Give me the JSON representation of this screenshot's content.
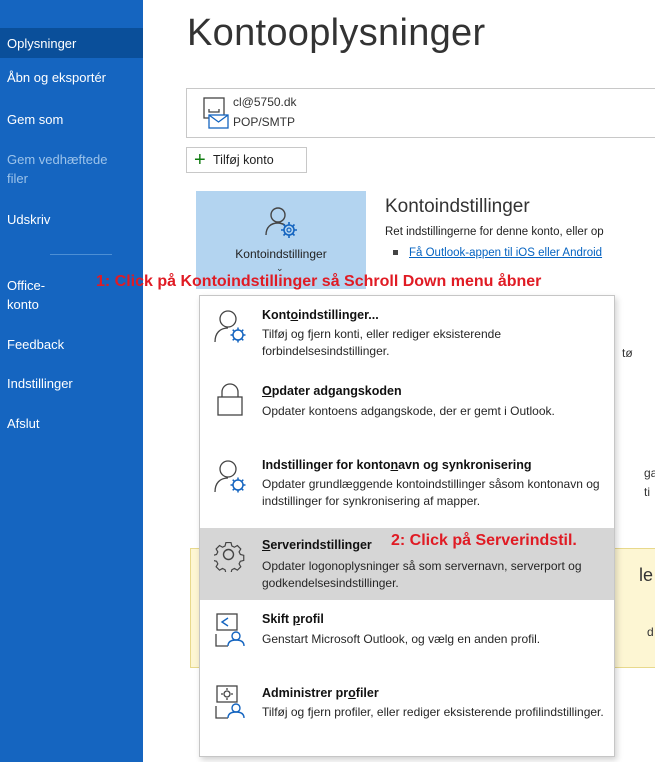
{
  "sidebar": {
    "items": [
      {
        "label": "Oplysninger"
      },
      {
        "label": "Åbn og eksportér"
      },
      {
        "label": "Gem som"
      },
      {
        "label": "Gem vedhæftede filer"
      },
      {
        "label": "Udskriv"
      },
      {
        "label": "Office-konto"
      },
      {
        "label": "Feedback"
      },
      {
        "label": "Indstillinger"
      },
      {
        "label": "Afslut"
      }
    ]
  },
  "main": {
    "title": "Kontooplysninger",
    "account": {
      "email": "cl@5750.dk",
      "type": "POP/SMTP"
    },
    "add_account_label": "Tilføj konto",
    "tile_label": "Kontoindstillinger",
    "section_title": "Kontoindstillinger",
    "section_desc": "Ret indstillingerne for denne konto, eller op",
    "section_link": "Få Outlook-appen til iOS eller Android"
  },
  "annotations": {
    "step1": "1: Click på Kontoindstillinger så Schroll Down menu åbner",
    "step2": "2: Click på Serverindstil."
  },
  "menu": {
    "items": [
      {
        "title_pre": "Kont",
        "title_u": "o",
        "title_post": "indstillinger...",
        "desc": "Tilføj og fjern konti, eller rediger eksisterende forbindelsesindstillinger.",
        "icon": "account-settings-icon"
      },
      {
        "title_pre": "",
        "title_u": "O",
        "title_post": "pdater adgangskoden",
        "desc": "Opdater kontoens adgangskode, der er gemt i Outlook.",
        "icon": "lock-icon"
      },
      {
        "title_pre": "Indstillinger for konto",
        "title_u": "n",
        "title_post": "avn og synkronisering",
        "desc": "Opdater grundlæggende kontoindstillinger såsom kontonavn og indstillinger for synkronisering af mapper.",
        "icon": "account-sync-icon"
      },
      {
        "title_pre": "",
        "title_u": "S",
        "title_post": "erverindstillinger",
        "desc": "Opdater logonoplysninger så som servernavn, serverport og godkendelsesindstillinger.",
        "icon": "gear-icon"
      },
      {
        "title_pre": "Skift ",
        "title_u": "p",
        "title_post": "rofil",
        "desc": "Genstart Microsoft Outlook, og vælg en anden profil.",
        "icon": "switch-profile-icon"
      },
      {
        "title_pre": "Administrer pr",
        "title_u": "o",
        "title_post": "filer",
        "desc": "Tilføj og fjern profiler, eller rediger eksisterende profilindstillinger.",
        "icon": "manage-profiles-icon"
      }
    ]
  },
  "background_fragments": [
    "tø",
    "ga",
    "ti",
    "le",
    "d"
  ],
  "colors": {
    "sidebar": "#1565c0",
    "sidebar_active": "#0a4f9a",
    "tile": "#b3d4f0",
    "annotation": "#e01b24",
    "highlight": "#d6d6d6"
  }
}
